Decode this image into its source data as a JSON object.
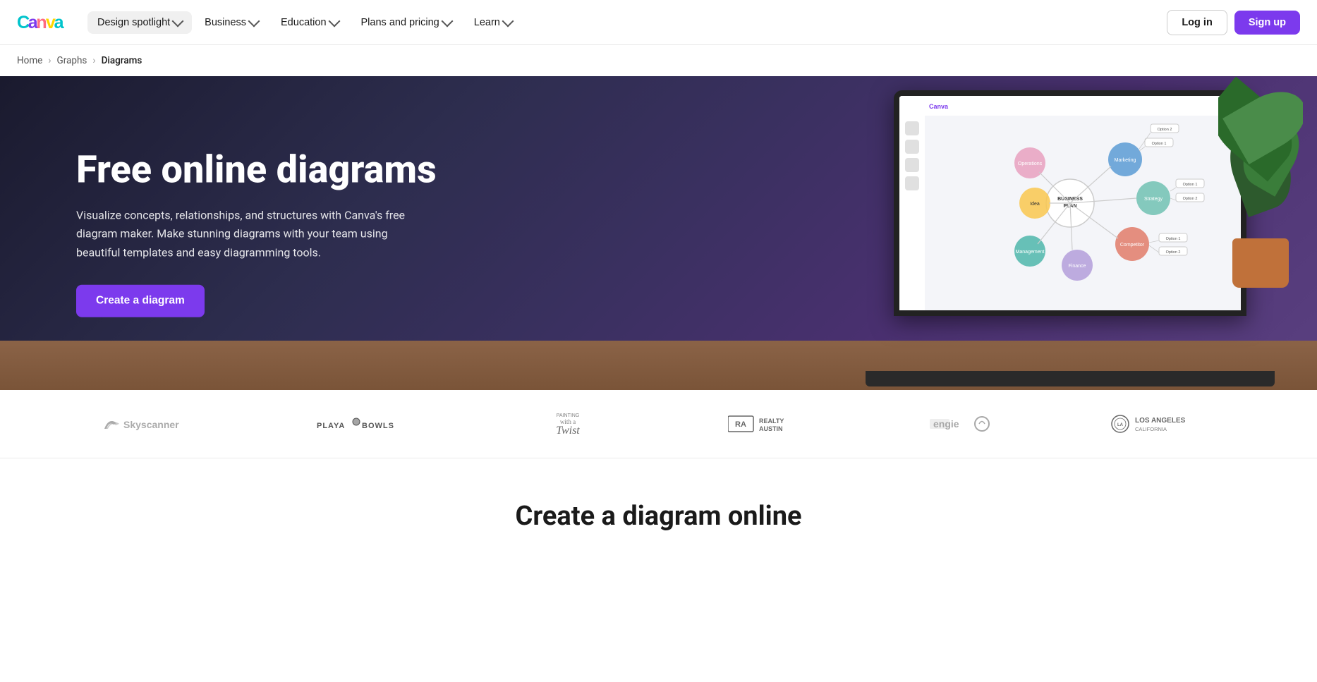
{
  "nav": {
    "logo_alt": "Canva",
    "items": [
      {
        "id": "design-spotlight",
        "label": "Design spotlight",
        "has_chevron": true
      },
      {
        "id": "business",
        "label": "Business",
        "has_chevron": true
      },
      {
        "id": "education",
        "label": "Education",
        "has_chevron": true
      },
      {
        "id": "plans-pricing",
        "label": "Plans and pricing",
        "has_chevron": true
      },
      {
        "id": "learn",
        "label": "Learn",
        "has_chevron": true
      }
    ],
    "login_label": "Log in",
    "signup_label": "Sign up"
  },
  "breadcrumb": {
    "items": [
      {
        "label": "Home",
        "link": true
      },
      {
        "label": "Graphs",
        "link": true
      },
      {
        "label": "Diagrams",
        "link": false
      }
    ]
  },
  "hero": {
    "title": "Free online diagrams",
    "subtitle": "Visualize concepts, relationships, and structures with Canva's free diagram maker. Make stunning diagrams with your team using beautiful templates and easy diagramming tools.",
    "cta_label": "Create a diagram"
  },
  "logos": [
    {
      "id": "skyscanner",
      "name": "Skyscanner"
    },
    {
      "id": "playa-bowls",
      "name": "Playa Bowls"
    },
    {
      "id": "painting-with-a-twist",
      "name": "Painting with a Twist"
    },
    {
      "id": "realty-austin",
      "name": "Realty Austin"
    },
    {
      "id": "engie",
      "name": "Engie"
    },
    {
      "id": "los-angeles",
      "name": "Los Angeles"
    }
  ],
  "bottom": {
    "title": "Create a diagram online"
  },
  "colors": {
    "primary_purple": "#7c3aed",
    "hero_bg_start": "#1a1a2e",
    "hero_bg_end": "#5a4080"
  }
}
